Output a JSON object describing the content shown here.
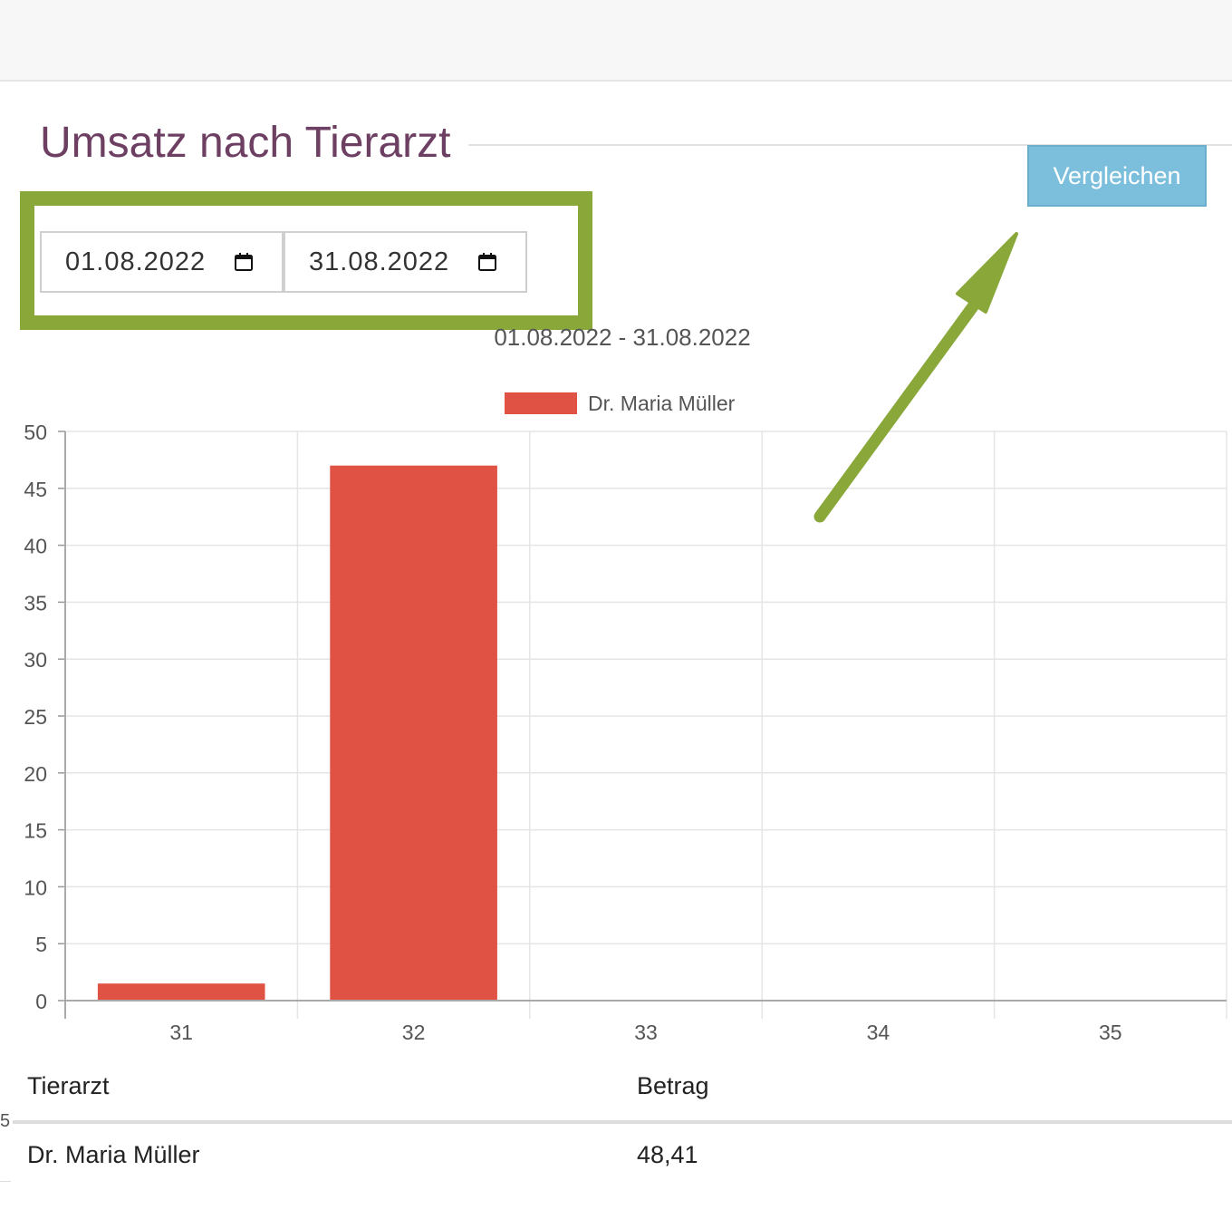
{
  "page": {
    "title": "Umsatz nach Tierarzt"
  },
  "toolbar": {
    "compare_label": "Vergleichen"
  },
  "date_range": {
    "from": "01.08.2022",
    "to": "31.08.2022",
    "calendar_icon": "calendar-icon"
  },
  "colors": {
    "title": "#6d3f63",
    "compare_button": "#7bbfdd",
    "highlight": "#8aa83a",
    "series": "#e05243",
    "grid": "#e5e5e5"
  },
  "chart_data": {
    "type": "bar",
    "title": "01.08.2022 - 31.08.2022",
    "categories": [
      "31",
      "32",
      "33",
      "34",
      "35"
    ],
    "series": [
      {
        "name": "Dr. Maria Müller",
        "values": [
          1.5,
          47,
          0,
          0,
          0
        ],
        "color": "#e05243"
      }
    ],
    "ylim": [
      0,
      50
    ],
    "yticks": [
      0,
      5,
      10,
      15,
      20,
      25,
      30,
      35,
      40,
      45,
      50
    ],
    "grid": true,
    "legend": "top-center",
    "xlabel": "",
    "ylabel": ""
  },
  "table": {
    "headers": [
      "Tierarzt",
      "Betrag"
    ],
    "rows": [
      {
        "vet": "Dr. Maria Müller",
        "amount": "48,41"
      }
    ]
  },
  "edge_fragment": "5"
}
